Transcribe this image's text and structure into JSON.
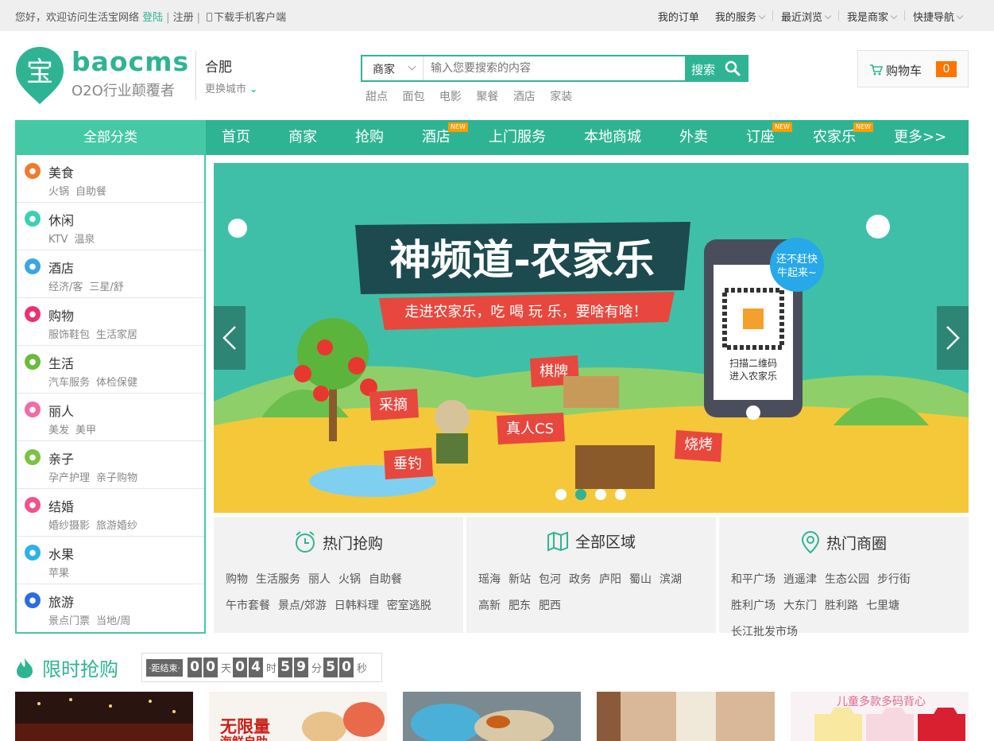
{
  "topbar": {
    "welcome": "您好，欢迎访问生活宝网络",
    "login": "登陆",
    "register": "注册",
    "download": "下载手机客户端",
    "links": [
      "我的订单",
      "我的服务",
      "最近浏览",
      "我是商家",
      "快捷导航"
    ]
  },
  "header": {
    "logo_char": "宝",
    "brand": "baocms",
    "slogan": "O2O行业颠覆者",
    "city": "合肥",
    "change_city": "更换城市",
    "search_type": "商家",
    "search_placeholder": "输入您要搜索的内容",
    "search_button": "搜索",
    "hot_words": [
      "甜点",
      "面包",
      "电影",
      "聚餐",
      "酒店",
      "家装"
    ],
    "cart_label": "购物车",
    "cart_count": "0"
  },
  "nav": {
    "all_categories": "全部分类",
    "items": [
      "首页",
      "商家",
      "抢购",
      "酒店",
      "上门服务",
      "本地商城",
      "外卖",
      "订座",
      "农家乐",
      "更多>>"
    ],
    "new_badge": "NEW"
  },
  "categories": [
    {
      "name": "美食",
      "subs": [
        "火锅",
        "自助餐"
      ],
      "color": "#f07a2e"
    },
    {
      "name": "休闲",
      "subs": [
        "KTV",
        "温泉"
      ],
      "color": "#3ccfb4"
    },
    {
      "name": "酒店",
      "subs": [
        "经济/客",
        "三星/舒"
      ],
      "color": "#3aa7e0"
    },
    {
      "name": "购物",
      "subs": [
        "服饰鞋包",
        "生活家居"
      ],
      "color": "#e8336f"
    },
    {
      "name": "生活",
      "subs": [
        "汽车服务",
        "体检保健"
      ],
      "color": "#6cba3e"
    },
    {
      "name": "丽人",
      "subs": [
        "美发",
        "美甲"
      ],
      "color": "#f06ba8"
    },
    {
      "name": "亲子",
      "subs": [
        "孕产护理",
        "亲子购物"
      ],
      "color": "#7cc242"
    },
    {
      "name": "结婚",
      "subs": [
        "婚纱摄影",
        "旅游婚纱"
      ],
      "color": "#f0528c"
    },
    {
      "name": "水果",
      "subs": [
        "苹果"
      ],
      "color": "#2eb2e8"
    },
    {
      "name": "旅游",
      "subs": [
        "景点门票",
        "当地/周"
      ],
      "color": "#2d6cdf"
    }
  ],
  "banner": {
    "title": "神频道-农家乐",
    "subtitle": "走进农家乐，吃 喝 玩 乐，要啥有啥！",
    "bubble": "还不赶快牛起来~",
    "qr_caption": "扫描二维码进入农家乐",
    "flags": [
      "棋牌",
      "采摘",
      "真人CS",
      "垂钓",
      "烧烤"
    ],
    "slide_count": 4,
    "active_slide": 2
  },
  "panels": [
    {
      "title": "热门抢购",
      "icon": "alarm-clock-icon",
      "links": [
        "购物",
        "生活服务",
        "丽人",
        "火锅",
        "自助餐",
        "午市套餐",
        "景点/郊游",
        "日韩料理",
        "密室逃脱"
      ]
    },
    {
      "title": "全部区域",
      "icon": "map-icon",
      "links": [
        "瑶海",
        "新站",
        "包河",
        "政务",
        "庐阳",
        "蜀山",
        "滨湖",
        "高新",
        "肥东",
        "肥西"
      ]
    },
    {
      "title": "热门商圈",
      "icon": "location-pin-icon",
      "links": [
        "和平广场",
        "逍遥津",
        "生态公园",
        "步行街",
        "胜利广场",
        "大东门",
        "胜利路",
        "七里塘",
        "长江批发市场"
      ]
    }
  ],
  "flash_sale": {
    "title": "限时抢购",
    "countdown_label": "·距结束·",
    "days": [
      "0",
      "0"
    ],
    "hours": [
      "0",
      "4"
    ],
    "minutes": [
      "5",
      "9"
    ],
    "seconds": [
      "5",
      "0"
    ],
    "units": [
      "天",
      "时",
      "分",
      "秒"
    ],
    "thumb_text_2": "无限量",
    "thumb_text_2b": "海鲜自助",
    "thumb_text_5": "儿童多款多码背心"
  },
  "colors": {
    "accent": "#2fb493",
    "accent_light": "#45c8a6",
    "orange": "#ff7300"
  }
}
